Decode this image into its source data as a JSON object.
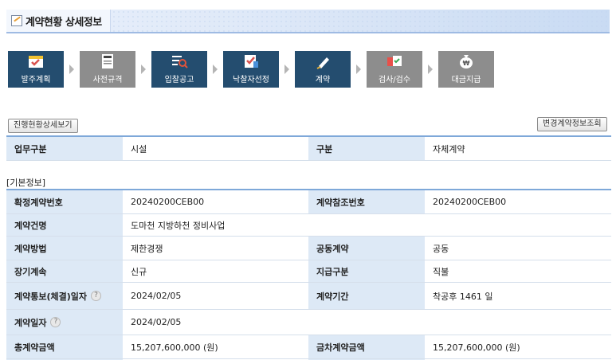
{
  "title": "계약현황 상세정보",
  "steps": [
    {
      "label": "발주계획",
      "icon": "calendar-check-icon",
      "active": true
    },
    {
      "label": "사전규격",
      "icon": "document-spec-icon",
      "active": false
    },
    {
      "label": "입찰공고",
      "icon": "search-list-icon",
      "active": true
    },
    {
      "label": "낙찰자선정",
      "icon": "checklist-icon",
      "active": true
    },
    {
      "label": "계약",
      "icon": "pen-sign-icon",
      "active": true
    },
    {
      "label": "검사/검수",
      "icon": "inspection-icon",
      "active": false
    },
    {
      "label": "대금지급",
      "icon": "money-bag-icon",
      "active": false
    }
  ],
  "buttons": {
    "progress_detail": "진행현황상세보기",
    "change_contract": "변경계약정보조회"
  },
  "summary": {
    "work_type_label": "업무구분",
    "work_type_value": "시설",
    "division_label": "구분",
    "division_value": "자체계약"
  },
  "basic_info_heading": "[기본정보]",
  "basic": {
    "contract_no_label": "확정계약번호",
    "contract_no_value": "20240200CEB00",
    "ref_no_label": "계약참조번호",
    "ref_no_value": "20240200CEB00",
    "contract_name_label": "계약건명",
    "contract_name_value": "도마천 지방하천 정비사업",
    "method_label": "계약방법",
    "method_value": "제한경쟁",
    "joint_label": "공동계약",
    "joint_value": "공동",
    "long_term_label": "장기계속",
    "long_term_value": "신규",
    "payment_type_label": "지급구분",
    "payment_type_value": "직불",
    "notice_date_label": "계약통보(체결)일자",
    "notice_date_value": "2024/02/05",
    "period_label": "계약기간",
    "period_value": "착공후 1461 일",
    "contract_date_label": "계약일자",
    "contract_date_value": "2024/02/05",
    "total_amount_label": "총계약금액",
    "total_amount_value": "15,207,600,000 (원)",
    "current_amount_label": "금차계약금액",
    "current_amount_value": "15,207,600,000 (원)"
  },
  "help_glyph": "?"
}
